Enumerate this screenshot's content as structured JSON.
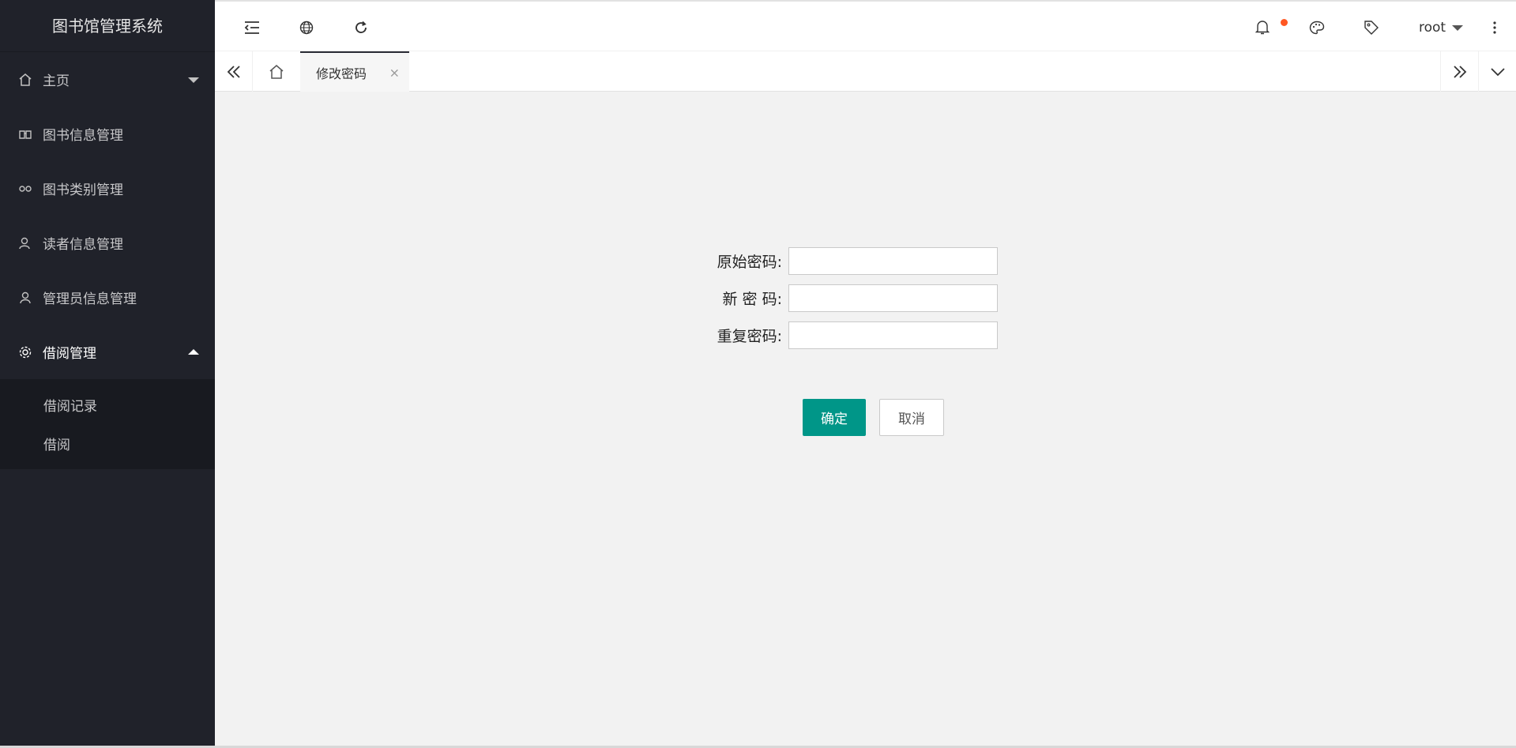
{
  "app": {
    "title": "图书馆管理系统"
  },
  "sidebar": {
    "items": [
      {
        "label": "主页",
        "icon": "home-icon",
        "arrow": "down"
      },
      {
        "label": "图书信息管理",
        "icon": "book-icon"
      },
      {
        "label": "图书类别管理",
        "icon": "link-icon"
      },
      {
        "label": "读者信息管理",
        "icon": "reader-icon"
      },
      {
        "label": "管理员信息管理",
        "icon": "user-icon"
      },
      {
        "label": "借阅管理",
        "icon": "gear-icon",
        "arrow": "up",
        "expanded": true
      }
    ],
    "subitems": [
      {
        "label": "借阅记录"
      },
      {
        "label": "借阅"
      }
    ]
  },
  "header": {
    "left_icons": [
      "collapse-menu-icon",
      "globe-icon",
      "refresh-icon"
    ],
    "right_icons": [
      "bell-icon",
      "palette-icon",
      "tag-icon"
    ],
    "user_name": "root",
    "more_icon": "more-vertical-icon"
  },
  "tabs": {
    "active_label": "修改密码",
    "close_glyph": "×"
  },
  "form": {
    "old_password_label": "原始密码:",
    "new_password_label": "新 密 码:",
    "repeat_password_label": "重复密码:",
    "old_password_value": "",
    "new_password_value": "",
    "repeat_password_value": "",
    "confirm_label": "确定",
    "cancel_label": "取消"
  },
  "colors": {
    "sidebar_bg": "#20222a",
    "subnav_bg": "#181a20",
    "primary": "#009688",
    "notify": "#ff5722"
  }
}
